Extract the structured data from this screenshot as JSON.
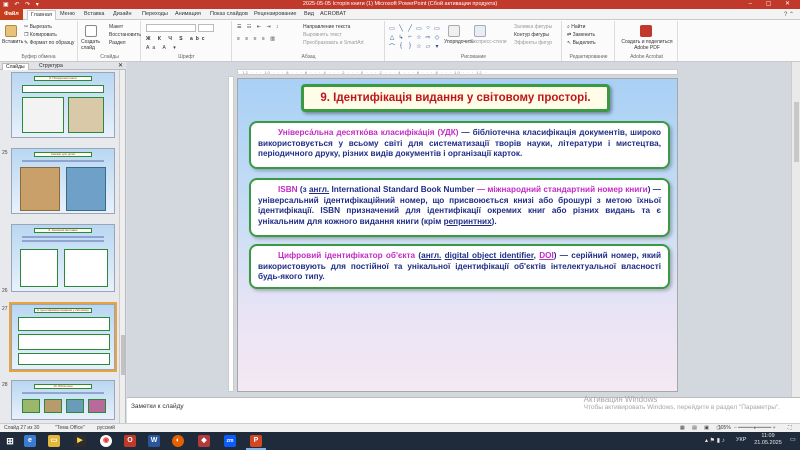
{
  "window": {
    "title": "2025-05-05 Історія книги (1) Microsoft PowerPoint (Сбой активации продукта)",
    "buttons": [
      "minimize",
      "maximize",
      "close"
    ]
  },
  "tabs": [
    "Файл",
    "Главная",
    "Меню",
    "Вставка",
    "Дизайн",
    "Переходы",
    "Анимация",
    "Показ слайдов",
    "Рецензирование",
    "Вид",
    "ACROBAT"
  ],
  "ribbon": {
    "clipboard": {
      "paste": "Вставить",
      "cut": "Вырезать",
      "copy": "Копировать",
      "format": "Формат по образцу",
      "label": "Буфер обмена"
    },
    "slides": {
      "create": "Создать слайд",
      "layout": "Макет",
      "reset": "Восстановить",
      "section": "Раздел",
      "label": "Слайды"
    },
    "font": {
      "label": "Шрифт"
    },
    "paragraph": {
      "direction": "Направление текста",
      "align": "Выровнять текст",
      "smartart": "Преобразовать в SmartArt",
      "label": "Абзац"
    },
    "drawing": {
      "arrange": "Упорядочить",
      "styles": "Экспресс-стили",
      "fill": "Заливка фигуры",
      "outline": "Контур фигуры",
      "effects": "Эффекты фигур",
      "label": "Рисование"
    },
    "editing": {
      "find": "Найти",
      "replace": "Заменить",
      "select": "Выделить",
      "label": "Редактирование"
    },
    "acrobat": {
      "create": "Создать и поделиться Adobe PDF",
      "label": "Adobe Acrobat"
    }
  },
  "left_panel": {
    "tabs": [
      "Слайды",
      "Структура"
    ],
    "thumbnails": [
      {
        "num": "",
        "title": "8. Поширення книги"
      },
      {
        "num": "25",
        "title": "Книжки для дітей"
      },
      {
        "num": "26",
        "title": "8. Книжкові виставки"
      },
      {
        "num": "27",
        "title": "9. Ідентифікація видання у світовому просторі."
      },
      {
        "num": "28",
        "title": "10. Бібліотеки"
      }
    ]
  },
  "slide": {
    "title": "9. Ідентифікація видання у світовому просторі.",
    "p1": {
      "term": "Універса́льна десятко́ва класифіка́ція (УДК)",
      "text": " — бібліотечна класифікація документів, широко використовується у всьому світі для систематизації творів науки, літератури і мистецтва, періодичного друку, різних видів документів і організації карток."
    },
    "p2": {
      "term": "ISBN",
      "part1": " (з ",
      "angl": "англ.",
      "part2": " International Standard Book Number ",
      "mag": "— міжнародний стандартний номер книги",
      "part3": ") — універсальний ідентифікаційний номер, що присвоюється книзі або брошурі з метою їхньої ідентифікації. ISBN призначений для ідентифікації окремих книг або різних видань та є унікальним для кожного видання книги (крім ",
      "reprint": "репринтних",
      "part4": ")."
    },
    "p3": {
      "term": "Цифровий ідентифікатор об'єкта",
      "part1": " (",
      "angl": "англ.",
      "space": " ",
      "doi_full": "digital object identifier",
      "comma": ", ",
      "doi": "DOI",
      "part2": ") — серійний номер, який використовують для постійної та унікальної ідентифікації об'єктів інтелектуальної власності будь-якого типу."
    }
  },
  "notes": {
    "placeholder": "Заметки к слайду"
  },
  "watermark": {
    "line1": "Активация Windows",
    "line2": "Чтобы активировать Windows, перейдите в раздел \"Параметры\"."
  },
  "status": {
    "slide": "Слайд 27 из 30",
    "theme": "\"Тема Office\"",
    "lang": "русский",
    "zoom": "105%"
  },
  "taskbar": {
    "lang": "УКР",
    "time": "11:09",
    "date": "21.05.2025"
  }
}
